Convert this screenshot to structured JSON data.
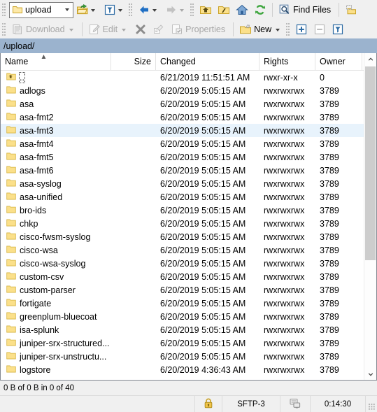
{
  "toolbar_top": {
    "path_combo": {
      "icon": "folder-icon",
      "value": "upload"
    },
    "items": [
      {
        "name": "open-directory-button",
        "icon": "open-folder-icon",
        "has_caret": true,
        "disabled": false
      },
      {
        "name": "filter-button",
        "icon": "funnel-icon",
        "has_caret": true,
        "disabled": false
      },
      {
        "name": "back-button",
        "icon": "back-arrow-icon",
        "has_caret": true,
        "disabled": false
      },
      {
        "name": "forward-button",
        "icon": "forward-arrow-icon",
        "has_caret": true,
        "disabled": true
      },
      {
        "name": "parent-directory-button",
        "icon": "folder-up-icon",
        "has_caret": false,
        "disabled": false
      },
      {
        "name": "root-directory-button",
        "icon": "folder-root-icon",
        "has_caret": false,
        "disabled": false
      },
      {
        "name": "home-directory-button",
        "icon": "home-icon",
        "has_caret": false,
        "disabled": false
      },
      {
        "name": "refresh-button",
        "icon": "refresh-icon",
        "has_caret": false,
        "disabled": false
      }
    ],
    "find_files": {
      "label": "Find Files",
      "icon": "magnifier-icon"
    },
    "bookmark": {
      "icon": "add-bookmark-icon"
    }
  },
  "toolbar_second": {
    "download": {
      "label": "Download",
      "icon": "download-icon",
      "has_caret": true,
      "disabled": true
    },
    "edit": {
      "label": "Edit",
      "icon": "edit-pencil-icon",
      "has_caret": true,
      "disabled": true
    },
    "delete": {
      "icon": "delete-x-icon",
      "disabled": true
    },
    "rename": {
      "icon": "rename-icon",
      "disabled": true
    },
    "properties": {
      "label": "Properties",
      "icon": "properties-icon",
      "disabled": true
    },
    "new": {
      "label": "New",
      "icon": "new-folder-icon",
      "has_caret": true,
      "disabled": false
    },
    "select": {
      "icon": "plus-box-icon",
      "disabled": false
    },
    "unselect": {
      "icon": "minus-box-icon",
      "disabled": true
    },
    "selection_filter": {
      "icon": "funnel-box-icon",
      "disabled": false
    }
  },
  "path_bar": {
    "path": "/upload/"
  },
  "file_list": {
    "columns": [
      {
        "key": "name",
        "label": "Name",
        "align": "left",
        "sorted": true,
        "sort_dir": "asc"
      },
      {
        "key": "size",
        "label": "Size",
        "align": "right"
      },
      {
        "key": "changed",
        "label": "Changed",
        "align": "left"
      },
      {
        "key": "rights",
        "label": "Rights",
        "align": "left"
      },
      {
        "key": "owner",
        "label": "Owner",
        "align": "left"
      }
    ],
    "rows": [
      {
        "name": "..",
        "icon": "parent-folder-icon",
        "size": "",
        "changed": "6/21/2019 11:51:51 AM",
        "rights": "rwxr-xr-x",
        "owner": "0",
        "selected": false,
        "focused": true
      },
      {
        "name": "adlogs",
        "icon": "folder-icon",
        "size": "",
        "changed": "6/20/2019 5:05:15 AM",
        "rights": "rwxrwxrwx",
        "owner": "3789",
        "selected": false,
        "focused": false
      },
      {
        "name": "asa",
        "icon": "folder-icon",
        "size": "",
        "changed": "6/20/2019 5:05:15 AM",
        "rights": "rwxrwxrwx",
        "owner": "3789",
        "selected": false,
        "focused": false
      },
      {
        "name": "asa-fmt2",
        "icon": "folder-icon",
        "size": "",
        "changed": "6/20/2019 5:05:15 AM",
        "rights": "rwxrwxrwx",
        "owner": "3789",
        "selected": false,
        "focused": false
      },
      {
        "name": "asa-fmt3",
        "icon": "folder-icon",
        "size": "",
        "changed": "6/20/2019 5:05:15 AM",
        "rights": "rwxrwxrwx",
        "owner": "3789",
        "selected": true,
        "focused": false
      },
      {
        "name": "asa-fmt4",
        "icon": "folder-icon",
        "size": "",
        "changed": "6/20/2019 5:05:15 AM",
        "rights": "rwxrwxrwx",
        "owner": "3789",
        "selected": false,
        "focused": false
      },
      {
        "name": "asa-fmt5",
        "icon": "folder-icon",
        "size": "",
        "changed": "6/20/2019 5:05:15 AM",
        "rights": "rwxrwxrwx",
        "owner": "3789",
        "selected": false,
        "focused": false
      },
      {
        "name": "asa-fmt6",
        "icon": "folder-icon",
        "size": "",
        "changed": "6/20/2019 5:05:15 AM",
        "rights": "rwxrwxrwx",
        "owner": "3789",
        "selected": false,
        "focused": false
      },
      {
        "name": "asa-syslog",
        "icon": "folder-icon",
        "size": "",
        "changed": "6/20/2019 5:05:15 AM",
        "rights": "rwxrwxrwx",
        "owner": "3789",
        "selected": false,
        "focused": false
      },
      {
        "name": "asa-unified",
        "icon": "folder-icon",
        "size": "",
        "changed": "6/20/2019 5:05:15 AM",
        "rights": "rwxrwxrwx",
        "owner": "3789",
        "selected": false,
        "focused": false
      },
      {
        "name": "bro-ids",
        "icon": "folder-icon",
        "size": "",
        "changed": "6/20/2019 5:05:15 AM",
        "rights": "rwxrwxrwx",
        "owner": "3789",
        "selected": false,
        "focused": false
      },
      {
        "name": "chkp",
        "icon": "folder-icon",
        "size": "",
        "changed": "6/20/2019 5:05:15 AM",
        "rights": "rwxrwxrwx",
        "owner": "3789",
        "selected": false,
        "focused": false
      },
      {
        "name": "cisco-fwsm-syslog",
        "icon": "folder-icon",
        "size": "",
        "changed": "6/20/2019 5:05:15 AM",
        "rights": "rwxrwxrwx",
        "owner": "3789",
        "selected": false,
        "focused": false
      },
      {
        "name": "cisco-wsa",
        "icon": "folder-icon",
        "size": "",
        "changed": "6/20/2019 5:05:15 AM",
        "rights": "rwxrwxrwx",
        "owner": "3789",
        "selected": false,
        "focused": false
      },
      {
        "name": "cisco-wsa-syslog",
        "icon": "folder-icon",
        "size": "",
        "changed": "6/20/2019 5:05:15 AM",
        "rights": "rwxrwxrwx",
        "owner": "3789",
        "selected": false,
        "focused": false
      },
      {
        "name": "custom-csv",
        "icon": "folder-icon",
        "size": "",
        "changed": "6/20/2019 5:05:15 AM",
        "rights": "rwxrwxrwx",
        "owner": "3789",
        "selected": false,
        "focused": false
      },
      {
        "name": "custom-parser",
        "icon": "folder-icon",
        "size": "",
        "changed": "6/20/2019 5:05:15 AM",
        "rights": "rwxrwxrwx",
        "owner": "3789",
        "selected": false,
        "focused": false
      },
      {
        "name": "fortigate",
        "icon": "folder-icon",
        "size": "",
        "changed": "6/20/2019 5:05:15 AM",
        "rights": "rwxrwxrwx",
        "owner": "3789",
        "selected": false,
        "focused": false
      },
      {
        "name": "greenplum-bluecoat",
        "icon": "folder-icon",
        "size": "",
        "changed": "6/20/2019 5:05:15 AM",
        "rights": "rwxrwxrwx",
        "owner": "3789",
        "selected": false,
        "focused": false
      },
      {
        "name": "isa-splunk",
        "icon": "folder-icon",
        "size": "",
        "changed": "6/20/2019 5:05:15 AM",
        "rights": "rwxrwxrwx",
        "owner": "3789",
        "selected": false,
        "focused": false
      },
      {
        "name": "juniper-srx-structured...",
        "icon": "folder-icon",
        "size": "",
        "changed": "6/20/2019 5:05:15 AM",
        "rights": "rwxrwxrwx",
        "owner": "3789",
        "selected": false,
        "focused": false
      },
      {
        "name": "juniper-srx-unstructu...",
        "icon": "folder-icon",
        "size": "",
        "changed": "6/20/2019 5:05:15 AM",
        "rights": "rwxrwxrwx",
        "owner": "3789",
        "selected": false,
        "focused": false
      },
      {
        "name": "logstore",
        "icon": "folder-icon",
        "size": "",
        "changed": "6/20/2019 4:36:43 AM",
        "rights": "rwxrwxrwx",
        "owner": "3789",
        "selected": false,
        "focused": false
      }
    ]
  },
  "selection_status": "0 B of 0 B in 0 of 40",
  "status_bar": {
    "lock_icon": "padlock-icon",
    "protocol": "SFTP-3",
    "monitor_icon": "remote-session-icon",
    "duration": "0:14:30"
  },
  "colors": {
    "pathbar_bg": "#9bb3ce",
    "selection_bg": "#e8f3fc",
    "folder_yellow": "#fbe08a",
    "accent_blue": "#1f6fc4"
  }
}
